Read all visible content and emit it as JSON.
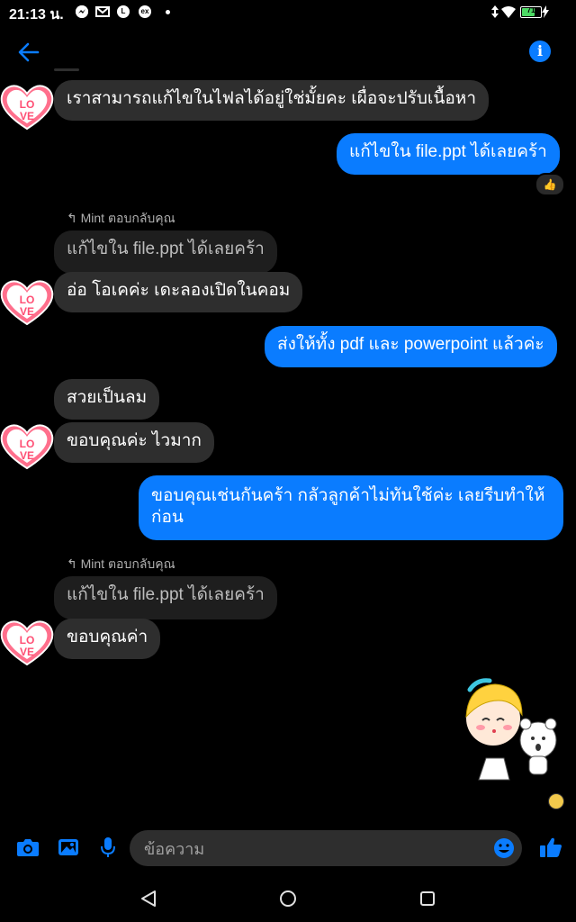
{
  "status_bar": {
    "time": "21:13 น.",
    "battery_level": "71",
    "icons": [
      "messenger-icon",
      "gmail-icon",
      "line-icon",
      "ex-icon",
      "dot-icon",
      "signal-icon",
      "wifi-icon",
      "battery-icon"
    ]
  },
  "header": {
    "back_icon": "back-arrow-icon",
    "info_icon": "info-icon",
    "info_glyph": "i"
  },
  "messages": [
    {
      "id": "m1",
      "type": "incoming",
      "text": "เราสามารถแก้ไขในไฟลได้อยู่ใช่มั้ยคะ เผื่อจะปรับเนื้อหา",
      "avatar": "love-heart-avatar"
    },
    {
      "id": "m2",
      "type": "outgoing",
      "text": "แก้ไขใน file.ppt ได้เลยคร้า",
      "reaction": "👍"
    },
    {
      "id": "m3",
      "type": "incoming-reply",
      "reply_label": "Mint ตอบกลับคุณ",
      "quoted": "แก้ไขใน file.ppt ได้เลยคร้า",
      "text": "อ่อ โอเคค่ะ เดะลองเปิดในคอม",
      "avatar": "love-heart-avatar"
    },
    {
      "id": "m4",
      "type": "outgoing",
      "text": "ส่งให้ทั้ง pdf และ powerpoint แล้วค่ะ"
    },
    {
      "id": "m5",
      "type": "incoming",
      "text": "สวยเป็นลม"
    },
    {
      "id": "m6",
      "type": "incoming",
      "text": "ขอบคุณค่ะ ไวมาก",
      "avatar": "love-heart-avatar"
    },
    {
      "id": "m7",
      "type": "outgoing",
      "lines": [
        "ขอบคุณเช่นกันคร้า กลัวลูกค้าไม่ทันใช้ค่ะ เลยรีบทำให้",
        "ก่อน"
      ]
    },
    {
      "id": "m8",
      "type": "incoming-reply",
      "reply_label": "Mint ตอบกลับคุณ",
      "quoted": "แก้ไขใน file.ppt ได้เลยคร้า",
      "text": "ขอบคุณค่า",
      "avatar": "love-heart-avatar"
    },
    {
      "id": "m9",
      "type": "sticker",
      "sticker": "girl-and-bear-sticker",
      "seen_avatar": "seen-avatar"
    }
  ],
  "love_text": "LOVE",
  "composer": {
    "placeholder": "ข้อความ",
    "icons": [
      "camera-icon",
      "image-icon",
      "mic-icon",
      "emoji-icon",
      "like-icon"
    ]
  },
  "nav_bar": {
    "icons": [
      "back-nav-icon",
      "home-nav-icon",
      "recents-nav-icon"
    ]
  }
}
